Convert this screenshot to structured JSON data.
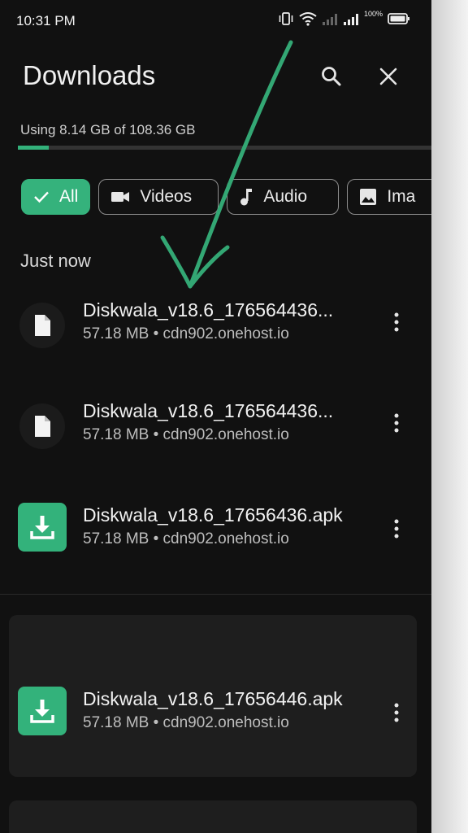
{
  "status_bar": {
    "time": "10:31 PM",
    "battery_percent": "100%"
  },
  "header": {
    "title": "Downloads",
    "search_icon": "search-icon",
    "close_icon": "close-icon"
  },
  "storage": {
    "text": "Using 8.14 GB of 108.36 GB",
    "used_fraction": 0.075
  },
  "filters": [
    {
      "label": "All",
      "icon": "check-icon",
      "active": true
    },
    {
      "label": "Videos",
      "icon": "video-icon",
      "active": false
    },
    {
      "label": "Audio",
      "icon": "music-note-icon",
      "active": false
    },
    {
      "label": "Ima",
      "icon": "image-icon",
      "active": false
    }
  ],
  "section_label": "Just now",
  "items": [
    {
      "name": "Diskwala_v18.6_176564436...",
      "meta": "57.18 MB • cdn902.onehost.io",
      "icon": "file-icon"
    },
    {
      "name": "Diskwala_v18.6_176564436...",
      "meta": "57.18 MB • cdn902.onehost.io",
      "icon": "file-icon"
    },
    {
      "name": "Diskwala_v18.6_17656436.apk",
      "meta": "57.18 MB • cdn902.onehost.io",
      "icon": "download-icon"
    },
    {
      "name": "Diskwala_v18.6_17656446.apk",
      "meta": "57.18 MB • cdn902.onehost.io",
      "icon": "download-icon"
    }
  ],
  "colors": {
    "accent": "#33b27b",
    "background": "#111111",
    "card": "#1e1e1e"
  }
}
